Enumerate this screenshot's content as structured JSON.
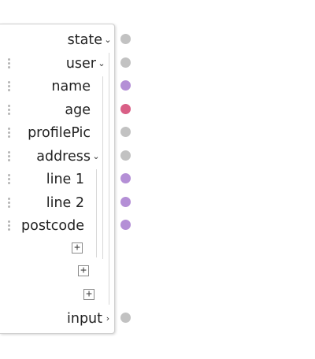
{
  "colors": {
    "grey": "#c2c2c2",
    "purple": "#b48fd6",
    "pink": "#d95f86"
  },
  "nodes": {
    "state": {
      "label": "state",
      "expand_icon": "chevron-down-icon",
      "port": "grey"
    },
    "user": {
      "label": "user",
      "expand_icon": "chevron-down-icon",
      "port": "grey"
    },
    "name": {
      "label": "name",
      "port": "purple"
    },
    "age": {
      "label": "age",
      "port": "pink"
    },
    "profilePic": {
      "label": "profilePic",
      "port": "grey"
    },
    "address": {
      "label": "address",
      "expand_icon": "chevron-down-icon",
      "port": "grey"
    },
    "line1": {
      "label": "line 1",
      "port": "purple"
    },
    "line2": {
      "label": "line 2",
      "port": "purple"
    },
    "postcode": {
      "label": "postcode",
      "port": "purple"
    },
    "input": {
      "label": "input",
      "expand_icon": "chevron-right-icon",
      "port": "grey"
    }
  },
  "add_buttons": {
    "address_add": "+",
    "user_add": "+",
    "state_add": "+"
  }
}
